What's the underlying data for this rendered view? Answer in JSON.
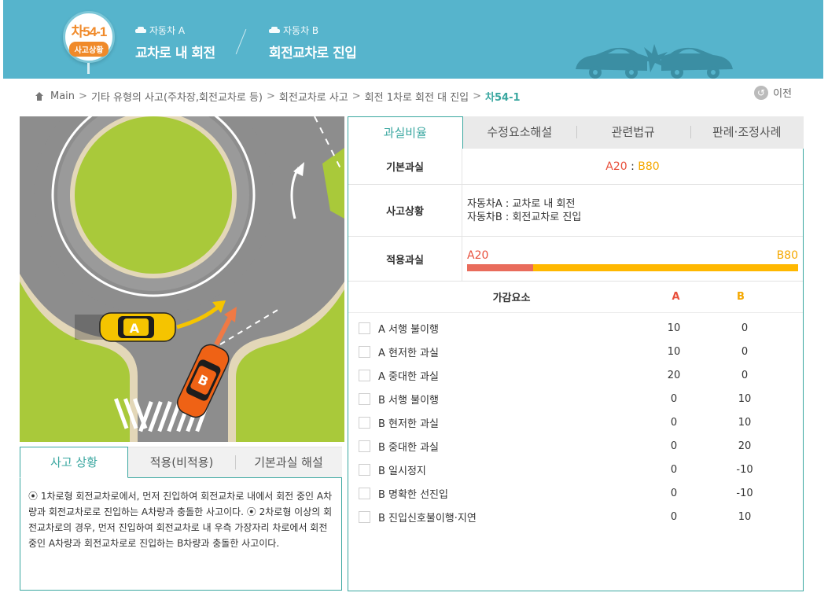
{
  "header": {
    "code": "차54-1",
    "subtitle": "사고상황",
    "vehicle_a_tag": "자동차 A",
    "vehicle_a_title": "교차로 내 회전",
    "vehicle_b_tag": "자동차 B",
    "vehicle_b_title": "회전교차로 진입"
  },
  "breadcrumb": {
    "items": [
      "Main",
      "기타 유형의 사고(주차장,회전교차로 등)",
      "회전교차로 사고",
      "회전 1차로 회전 대 진입"
    ],
    "current": "차54-1",
    "separator": ">"
  },
  "back_label": "이전",
  "scene": {
    "car_a_label": "A",
    "car_b_label": "B"
  },
  "left_tabs": [
    "사고 상황",
    "적용(비적용)",
    "기본과실 해설"
  ],
  "description": "⦿ 1차로형 회전교차로에서, 먼저 진입하여 회전교차로 내에서 회전 중인 A차량과 회전교차로로 진입하는 A차량과 충돌한 사고이다. ⦿ 2차로형 이상의 회전교차로의 경우, 먼저 진입하여 회전교차로 내 우측 가장자리 차로에서 회전 중인 A차량과 회전교차로로 진입하는 B차량과 충돌한 사고이다.",
  "right_tabs": [
    "과실비율",
    "수정요소해설",
    "관련법규",
    "판례·조정사례"
  ],
  "fault": {
    "base_label": "기본과실",
    "base_a": "A20",
    "base_colon": " : ",
    "base_b": "B80",
    "situation_label": "사고상황",
    "situation_lines": [
      "자동차A : 교차로 내 회전",
      "자동차B : 회전교차로 진입"
    ],
    "applied_label": "적용과실",
    "applied_a": "A20",
    "applied_b": "B80",
    "applied_a_ratio": 0.2
  },
  "modifiers": {
    "header_name": "가감요소",
    "header_a": "A",
    "header_b": "B",
    "rows": [
      {
        "name": "A 서행 불이행",
        "a": "10",
        "b": "0"
      },
      {
        "name": "A 현저한 과실",
        "a": "10",
        "b": "0"
      },
      {
        "name": "A 중대한 과실",
        "a": "20",
        "b": "0"
      },
      {
        "name": "B 서행 불이행",
        "a": "0",
        "b": "10"
      },
      {
        "name": "B 현저한 과실",
        "a": "0",
        "b": "10"
      },
      {
        "name": "B 중대한 과실",
        "a": "0",
        "b": "20"
      },
      {
        "name": "B 일시정지",
        "a": "0",
        "b": "-10"
      },
      {
        "name": "B 명확한 선진입",
        "a": "0",
        "b": "-10"
      },
      {
        "name": "B 진입신호불이행·지연",
        "a": "0",
        "b": "10"
      }
    ]
  },
  "colors": {
    "header_bg": "#56b4cc",
    "accent": "#3aa7a0",
    "badge_orange": "#f08a2a",
    "party_a": "#e8503c",
    "party_b": "#f5a800"
  }
}
